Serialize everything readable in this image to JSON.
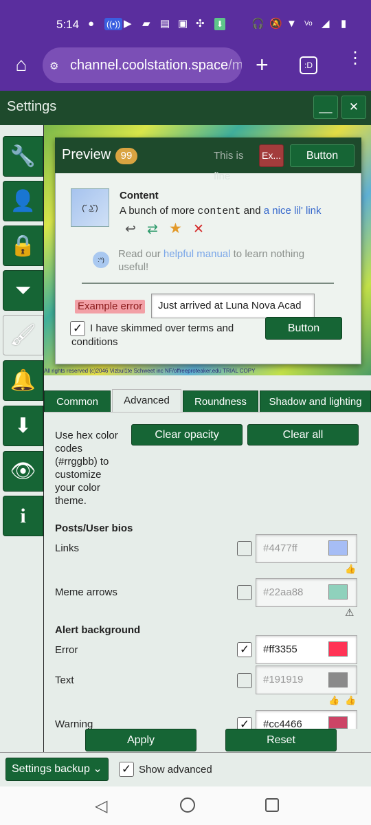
{
  "status": {
    "time": "5:14"
  },
  "browser": {
    "url_main": "channel.coolstation.space",
    "url_rest": "/m"
  },
  "window": {
    "title": "Settings",
    "minimize_label": "__",
    "close_label": "✕"
  },
  "sidebar": {
    "icons": [
      "wrench-icon",
      "user-icon",
      "lock-icon",
      "filter-icon",
      "brush-icon",
      "bell-icon",
      "download-icon",
      "eye-slash-icon",
      "info-icon"
    ],
    "active": "brush-icon"
  },
  "banner": {
    "footer_text": "All rights reserved (c)2046 Vizbul1te Schweet inc NF/offreeproteaker.edu TRIAL COPY"
  },
  "preview": {
    "title": "Preview",
    "badge": "99",
    "faint_text": "This is",
    "faint_text2": "fine",
    "error_button": "Ex...",
    "button_label": "Button",
    "post": {
      "avatar_text": "(˘ ͜ʖ˘)",
      "heading": "Content",
      "body_prefix": "A bunch of more",
      "body_mono": "content",
      "body_and": "and",
      "body_link": "a nice lil' link"
    },
    "note": {
      "avatar_text": ":^)",
      "prefix": "Read our",
      "link": "helpful manual",
      "suffix1": "to learn nothing",
      "suffix2": "useful!"
    },
    "error_label": "Example error",
    "input_value": "Just arrived at Luna Nova Acad",
    "checkbox_label_1": "I have skimmed over terms and",
    "checkbox_label_2": "conditions",
    "checkbox_mark": "✓",
    "button2_label": "Button"
  },
  "tabs": [
    {
      "label": "Common"
    },
    {
      "label": "Advanced"
    },
    {
      "label": "Roundness"
    },
    {
      "label": "Shadow and lighting"
    }
  ],
  "active_tab": "Advanced",
  "advanced": {
    "intro": [
      "Use hex color",
      "codes",
      "(#rrggbb) to",
      "customize",
      "your color",
      "theme."
    ],
    "clear_opacity": "Clear opacity",
    "clear_all": "Clear all",
    "section_posts": "Posts/User bios",
    "section_alert": "Alert background",
    "rows": [
      {
        "label": "Links",
        "checked": false,
        "value": "#4477ff",
        "color": "#a6bdf5",
        "hint": "thumbs-up-icon"
      },
      {
        "label": "Meme arrows",
        "checked": false,
        "value": "#22aa88",
        "color": "#8fd1bc",
        "hint": "warning-icon"
      },
      {
        "label": "Error",
        "checked": true,
        "value": "#ff3355",
        "color": "#ff3355",
        "hint": ""
      },
      {
        "label": "Text",
        "checked": false,
        "value": "#191919",
        "color": "#8a8a8a",
        "hint": "thumbs-up-icon x2"
      },
      {
        "label": "Warning",
        "checked": true,
        "value": "#cc4466",
        "color": "#cc4466",
        "hint": ""
      }
    ]
  },
  "footer": {
    "apply": "Apply",
    "reset": "Reset",
    "backup": "Settings backup",
    "show_advanced": "Show advanced",
    "show_advanced_checked": true
  },
  "colors": {
    "purple": "#5a2e9e",
    "dark_green": "#1e4a2c",
    "button_green": "#166535",
    "panel_bg": "#e6ede9",
    "link_blue": "#3366cc"
  }
}
